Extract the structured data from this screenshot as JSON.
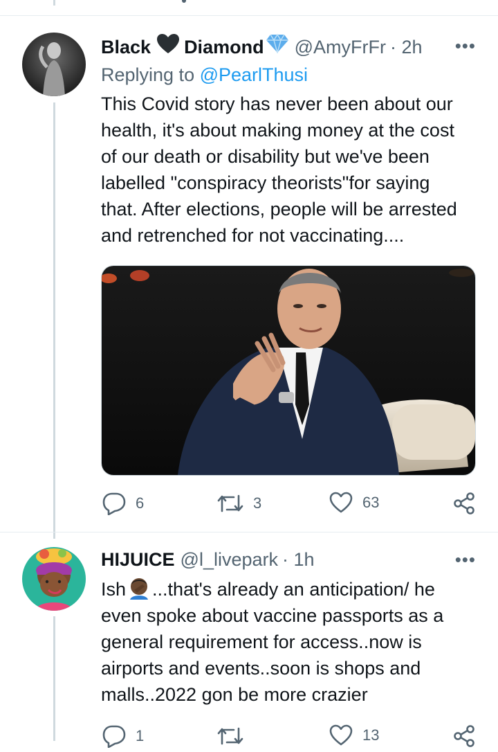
{
  "tweet1": {
    "name_first": "Black",
    "name_second": "Diamond",
    "handle": "@AmyFrFr",
    "time": "· 2h",
    "more": "•••",
    "replying_prefix": "Replying to ",
    "replying_to": "@PearlThusi",
    "lines": [
      "This Covid story has never been about our",
      "health, it's about making money at the cost",
      "of our death or disability but we've been",
      "labelled \"conspiracy theorists\"for saying",
      "that. After elections, people will be arrested",
      "and retrenched for not vaccinating...."
    ],
    "replies": "6",
    "retweets": "3",
    "likes": "63"
  },
  "tweet2": {
    "name": "HIJUICE",
    "handle": "@l_livepark",
    "time": "· 1h",
    "more": "•••",
    "line1_pre": "Ish",
    "line1_post": "...that's already an anticipation/  he",
    "lines": [
      "even spoke about  vaccine passports as a",
      "general requirement for access..now is",
      "airports and events..soon is shops and",
      "malls..2022 gon be more crazier"
    ],
    "replies": "1",
    "likes": "13"
  },
  "icons": {
    "reply": "reply-icon",
    "retweet": "retweet-icon",
    "like": "heart-icon",
    "share": "share-icon"
  },
  "colors": {
    "accent": "#1d9bf0",
    "secondary_text": "#536471",
    "thread_line": "#cfd9de"
  }
}
